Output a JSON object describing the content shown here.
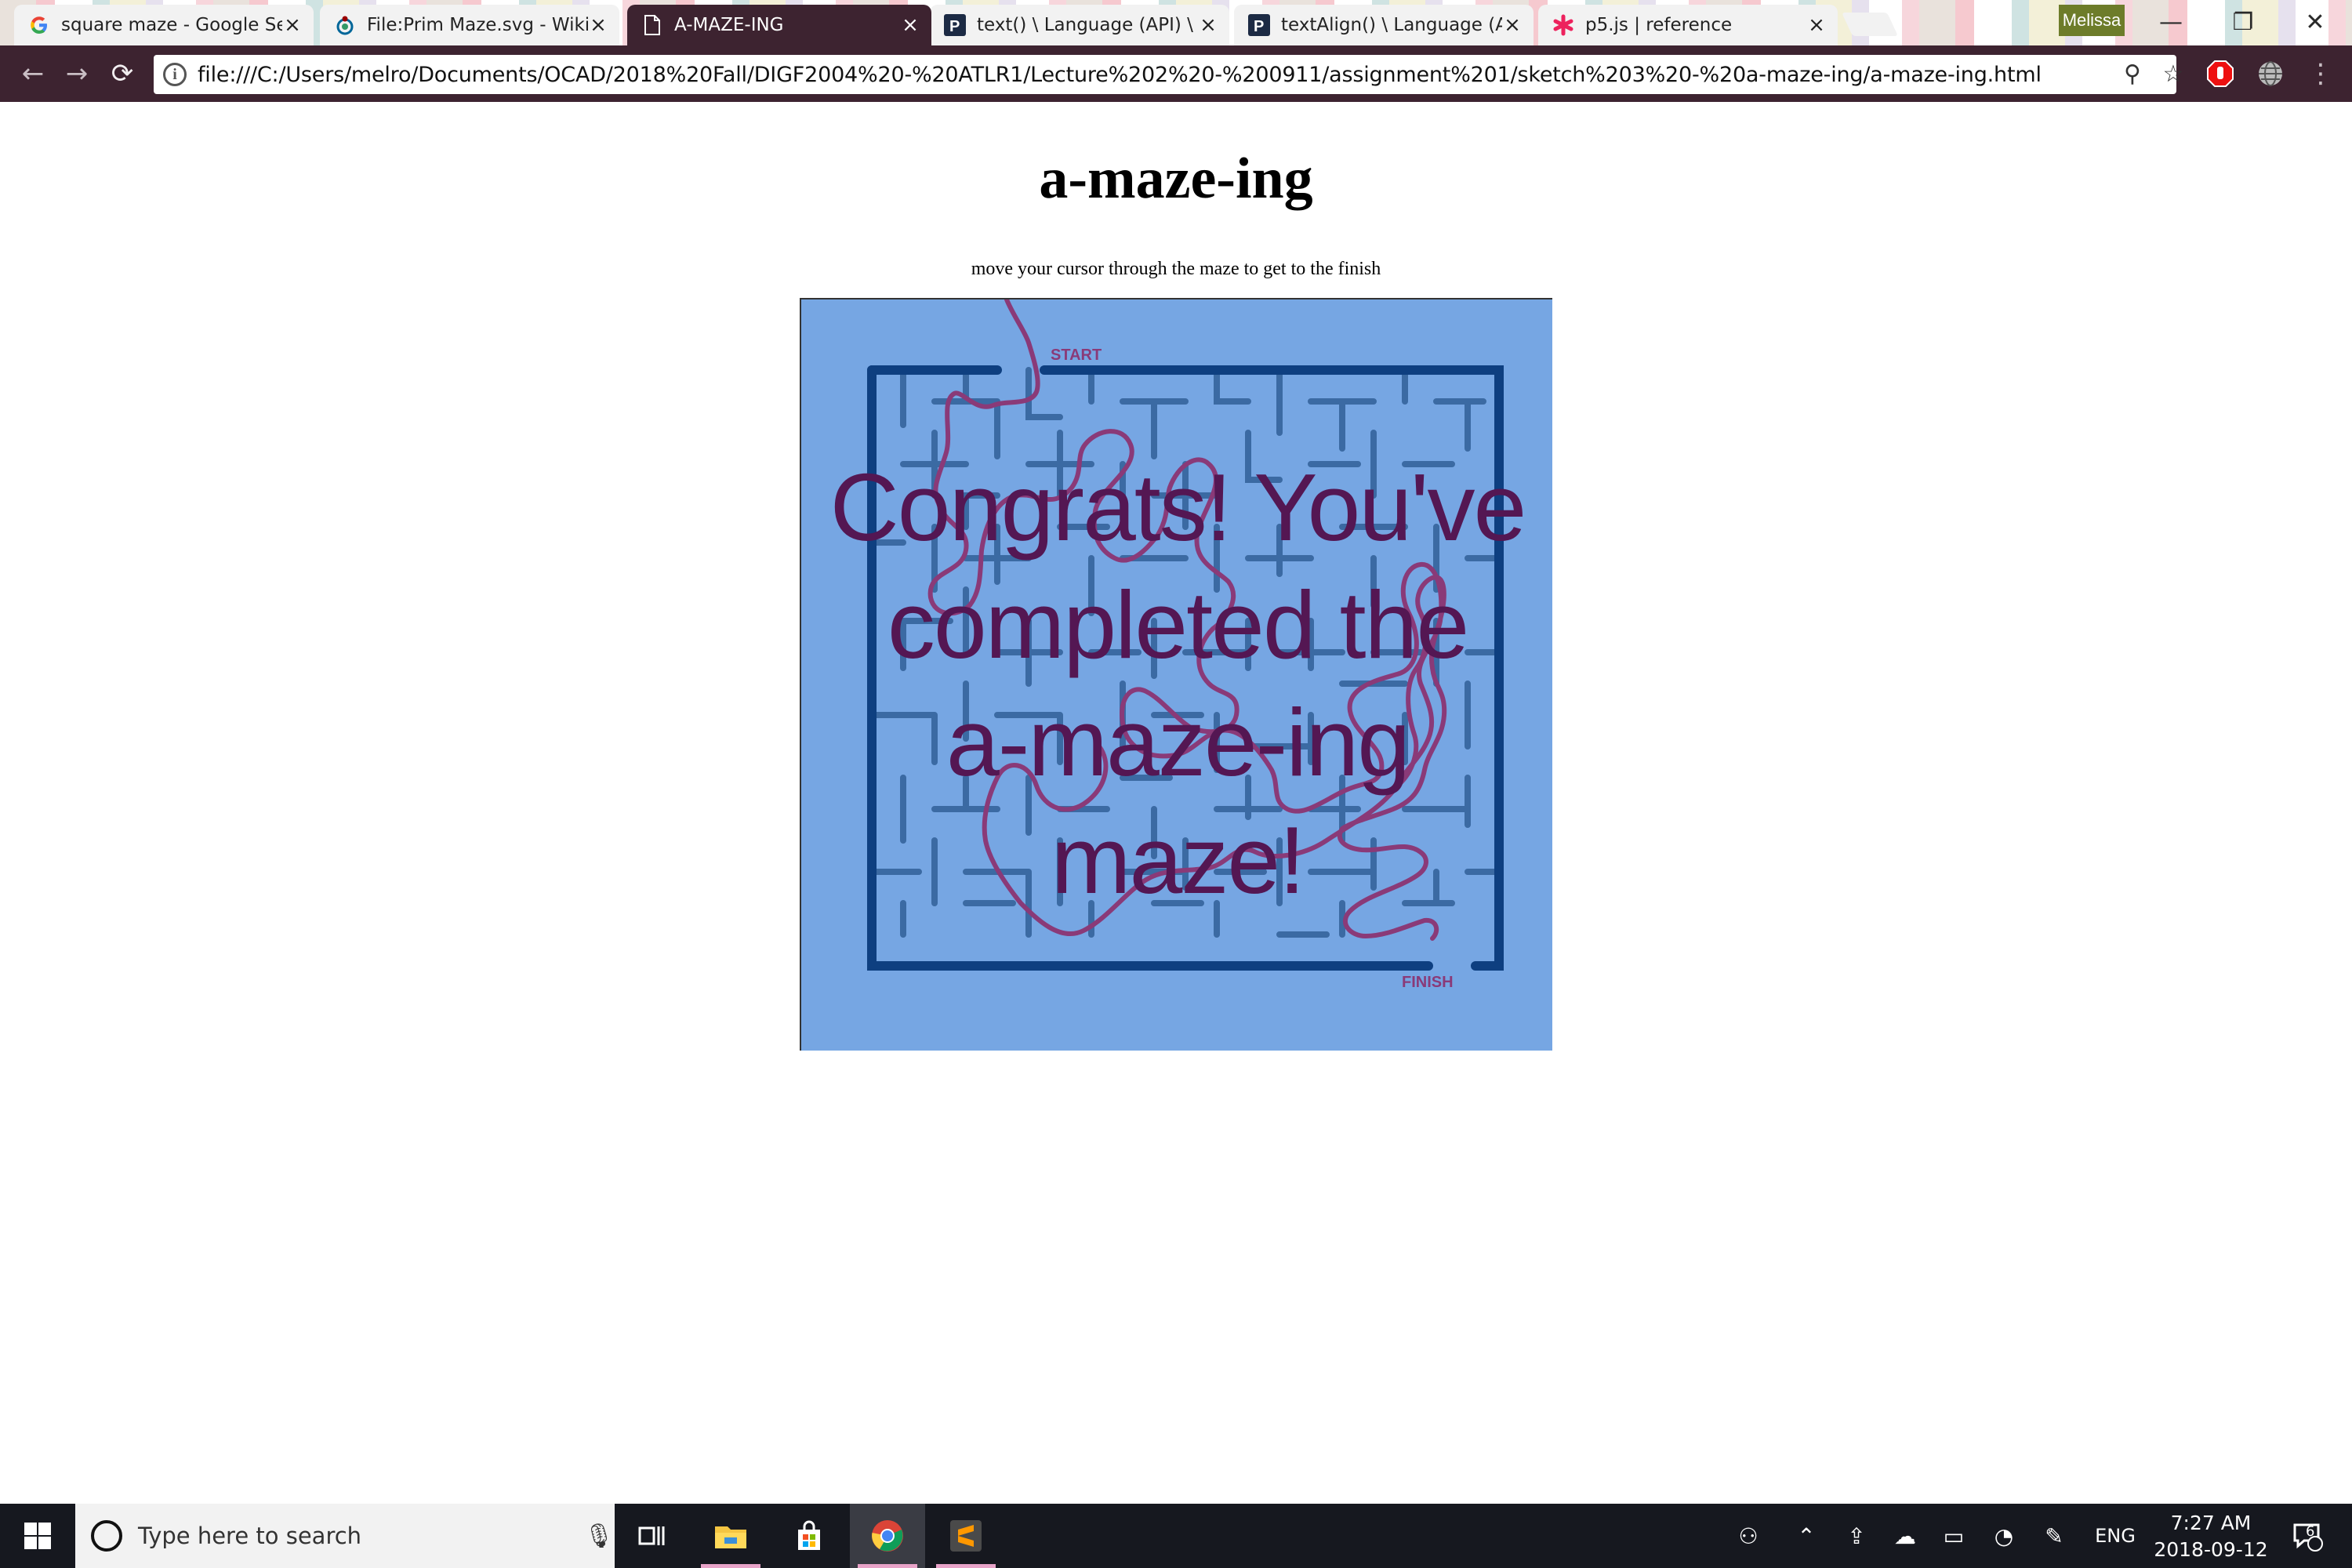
{
  "browser": {
    "tabs": [
      {
        "title": "square maze - Google Se",
        "icon": "google-icon",
        "active": false
      },
      {
        "title": "File:Prim Maze.svg - Wiki",
        "icon": "wikimedia-icon",
        "active": false
      },
      {
        "title": "A-MAZE-ING",
        "icon": "document-icon",
        "active": true
      },
      {
        "title": "text() \\ Language (API) \\ P",
        "icon": "processing-icon",
        "active": false
      },
      {
        "title": "textAlign() \\ Language (A",
        "icon": "processing-icon",
        "active": false
      },
      {
        "title": "p5.js | reference",
        "icon": "p5js-icon",
        "active": false
      }
    ],
    "profile_name": "Melissa",
    "url": "file:///C:/Users/melro/Documents/OCAD/2018%20Fall/DIGF2004%20-%20ATLR1/Lecture%202%20-%200911/assignment%201/sketch%203%20-%20a-maze-ing/a-maze-ing.html",
    "colors": {
      "toolbar": "#3d2330",
      "active_tab": "#3d2330"
    }
  },
  "page": {
    "title": "a-maze-ing",
    "subtitle": "move your cursor through the maze to get to the finish",
    "maze": {
      "start_label": "START",
      "finish_label": "FINISH",
      "message": "Congrats! You've completed the a-maze-ing maze!",
      "message_lines": [
        "Congrats! You've",
        "completed the",
        "a-maze-ing",
        "maze!"
      ],
      "colors": {
        "background": "#76a6e3",
        "walls": "#3b6aa3",
        "border": "#0e3f80",
        "trail": "#8a3a78",
        "message": "#541753"
      }
    }
  },
  "taskbar": {
    "search_placeholder": "Type here to search",
    "apps": [
      "task-view-icon",
      "file-explorer-icon",
      "store-icon",
      "chrome-icon",
      "sublime-text-icon"
    ],
    "language": "ENG",
    "time": "7:27 AM",
    "date": "2018-09-12",
    "notification_count": "6"
  }
}
